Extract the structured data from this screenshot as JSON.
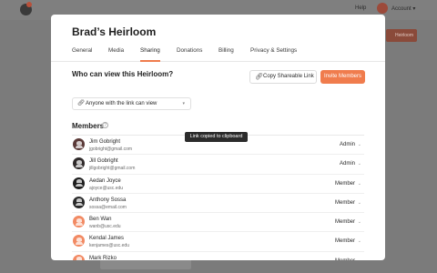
{
  "background": {
    "help_label": "Help",
    "account_label": "Account",
    "account_chevron": "▾",
    "button_fragment": "Heirloom"
  },
  "modal": {
    "title": "Brad’s Heirloom",
    "tabs": [
      {
        "label": "General"
      },
      {
        "label": "Media"
      },
      {
        "label": "Sharing",
        "active": true
      },
      {
        "label": "Donations"
      },
      {
        "label": "Billing"
      },
      {
        "label": "Privacy & Settings"
      }
    ],
    "sharing": {
      "question": "Who can view this Heirloom?",
      "copy_link_label": "Copy Shareable Link",
      "invite_label": "Invite Members",
      "permission_value": "Anyone with the link can view",
      "members_heading": "Members",
      "tooltip": "Link copied to clipboard"
    },
    "members": [
      {
        "name": "Jim Gobright",
        "email": "jgobright@gmail.com",
        "role": "Admin",
        "avatar_color": "#5b3a38"
      },
      {
        "name": "Jill Gobright",
        "email": "jillgobright@gmail.com",
        "role": "Admin",
        "avatar_color": "#2f2a2a"
      },
      {
        "name": "Aedan Joyce",
        "email": "ajoyce@usc.edu",
        "role": "Member",
        "avatar_color": "#1e1e1e"
      },
      {
        "name": "Anthony Sossa",
        "email": "sossa@email.com",
        "role": "Member",
        "avatar_color": "#2a2a2a"
      },
      {
        "name": "Ben Wan",
        "email": "wanb@usc.edu",
        "role": "Member",
        "avatar_color": "#f28a63"
      },
      {
        "name": "Kendal James",
        "email": "kenjames@usc.edu",
        "role": "Member",
        "avatar_color": "#f28a63"
      },
      {
        "name": "Mark Rizko",
        "email": "rizko@gmail.com",
        "role": "Member",
        "avatar_color": "#f28a63"
      }
    ]
  },
  "colors": {
    "accent": "#f07c4d",
    "tooltip_bg": "#2b2b2b"
  }
}
